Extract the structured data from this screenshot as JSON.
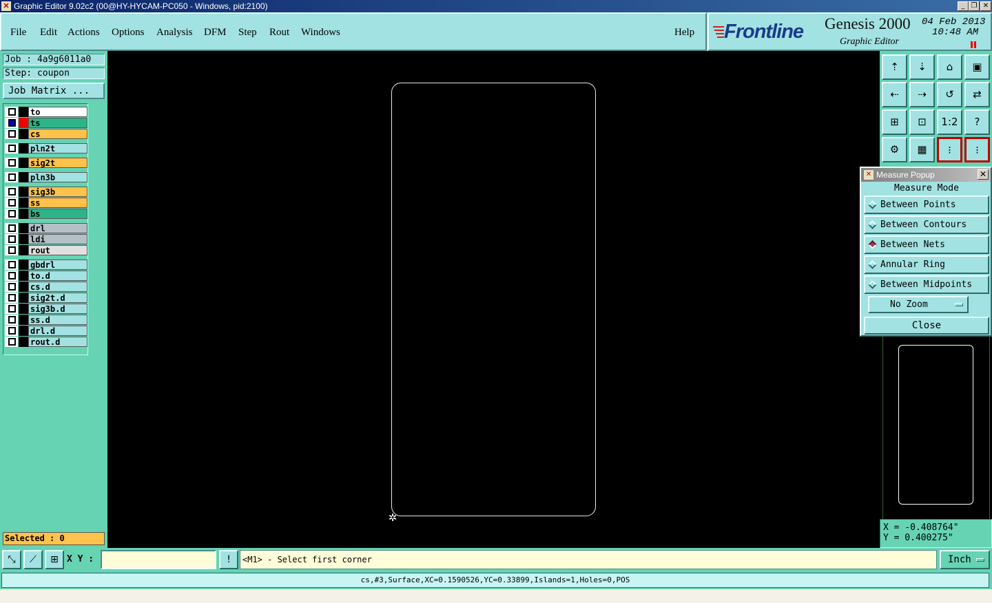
{
  "window": {
    "title": "Graphic Editor 9.02c2 (00@HY-HYCAM-PC050 - Windows, pid:2100)",
    "app_icon": "app-icon",
    "minimize": "_",
    "restore": "❐",
    "close": "✕"
  },
  "menu": {
    "items": [
      "File",
      "Edit",
      "Actions",
      "Options",
      "Analysis",
      "DFM",
      "Step",
      "Rout",
      "Windows"
    ],
    "help": "Help"
  },
  "brand": {
    "logo": "Frontline",
    "product": "Genesis 2000",
    "subtitle": "Graphic Editor",
    "date": "04 Feb 2013",
    "time": "10:48 AM"
  },
  "job": {
    "job_label": "Job : 4a9g6011a0",
    "step_label": "Step: coupon",
    "matrix_button": "Job Matrix ..."
  },
  "layers": [
    {
      "name": "to",
      "color": "#ffffff",
      "marker": "black",
      "active": false
    },
    {
      "name": "ts",
      "color": "#2db489",
      "marker": "red",
      "active": true
    },
    {
      "name": "cs",
      "color": "#ffc24a",
      "marker": "black",
      "active": false
    },
    {
      "name": "pln2t",
      "color": "#a2e2e2",
      "marker": "black",
      "active": false
    },
    {
      "name": "sig2t",
      "color": "#ffc24a",
      "marker": "black",
      "active": false
    },
    {
      "name": "pln3b",
      "color": "#a2e2e2",
      "marker": "black",
      "active": false
    },
    {
      "name": "sig3b",
      "color": "#ffc24a",
      "marker": "black",
      "active": false
    },
    {
      "name": "ss",
      "color": "#ffc24a",
      "marker": "black",
      "active": false
    },
    {
      "name": "bs",
      "color": "#2db489",
      "marker": "black",
      "active": false
    },
    {
      "name": "drl",
      "color": "#b4c0c8",
      "marker": "black",
      "active": false
    },
    {
      "name": "ldi",
      "color": "#b4c0c8",
      "marker": "black",
      "active": false
    },
    {
      "name": "rout",
      "color": "#e0e0e0",
      "marker": "black",
      "active": false
    },
    {
      "name": "gbdrl",
      "color": "#a2e2e2",
      "marker": "black",
      "active": false
    },
    {
      "name": "to.d",
      "color": "#a2e2e2",
      "marker": "black",
      "active": false
    },
    {
      "name": "cs.d",
      "color": "#a2e2e2",
      "marker": "black",
      "active": false
    },
    {
      "name": "sig2t.d",
      "color": "#a2e2e2",
      "marker": "black",
      "active": false
    },
    {
      "name": "sig3b.d",
      "color": "#a2e2e2",
      "marker": "black",
      "active": false
    },
    {
      "name": "ss.d",
      "color": "#a2e2e2",
      "marker": "black",
      "active": false
    },
    {
      "name": "drl.d",
      "color": "#a2e2e2",
      "marker": "black",
      "active": false
    },
    {
      "name": "rout.d",
      "color": "#a2e2e2",
      "marker": "black",
      "active": false
    }
  ],
  "selected": "Selected : 0",
  "toolbar": {
    "tools": [
      {
        "name": "pan-up-icon",
        "glyph": "⇡"
      },
      {
        "name": "pan-down-icon",
        "glyph": "⇣"
      },
      {
        "name": "home-icon",
        "glyph": "⌂"
      },
      {
        "name": "window-zoom-icon",
        "glyph": "▣"
      },
      {
        "name": "pan-left-icon",
        "glyph": "⇠"
      },
      {
        "name": "pan-right-icon",
        "glyph": "⇢"
      },
      {
        "name": "redraw-icon",
        "glyph": "↺"
      },
      {
        "name": "swap-icon",
        "glyph": "⇄"
      },
      {
        "name": "zoom-in-icon",
        "glyph": "⊞"
      },
      {
        "name": "zoom-out-icon",
        "glyph": "⊡"
      },
      {
        "name": "scale-1-2-icon",
        "glyph": "1:2"
      },
      {
        "name": "help-icon",
        "glyph": "?"
      },
      {
        "name": "measure-tool-icon",
        "glyph": "⚙"
      },
      {
        "name": "grid-icon",
        "glyph": "▦"
      },
      {
        "name": "net-highlight-icon",
        "glyph": "⁝",
        "red": true
      },
      {
        "name": "net-select-icon",
        "glyph": "⁝",
        "red": true
      }
    ]
  },
  "coords": {
    "x": "X = -0.408764\"",
    "y": "Y = 0.400275\""
  },
  "measure_popup": {
    "title": "Measure Popup",
    "mode_label": "Measure Mode",
    "options": [
      {
        "label": "Between Points",
        "selected": false
      },
      {
        "label": "Between Contours",
        "selected": false
      },
      {
        "label": "Between Nets",
        "selected": true
      },
      {
        "label": "Annular Ring",
        "selected": false
      },
      {
        "label": "Between Midpoints",
        "selected": false
      }
    ],
    "zoom_value": "No Zoom",
    "close_label": "Close"
  },
  "bottom": {
    "xy_label": "X Y :",
    "xy_value": "",
    "prompt": "<M1> - Select first corner",
    "unit": "Inch",
    "status": "cs,#3,Surface,XC=0.1590526,YC=0.33899,Islands=1,Holes=0,POS",
    "info_icon": "!"
  }
}
